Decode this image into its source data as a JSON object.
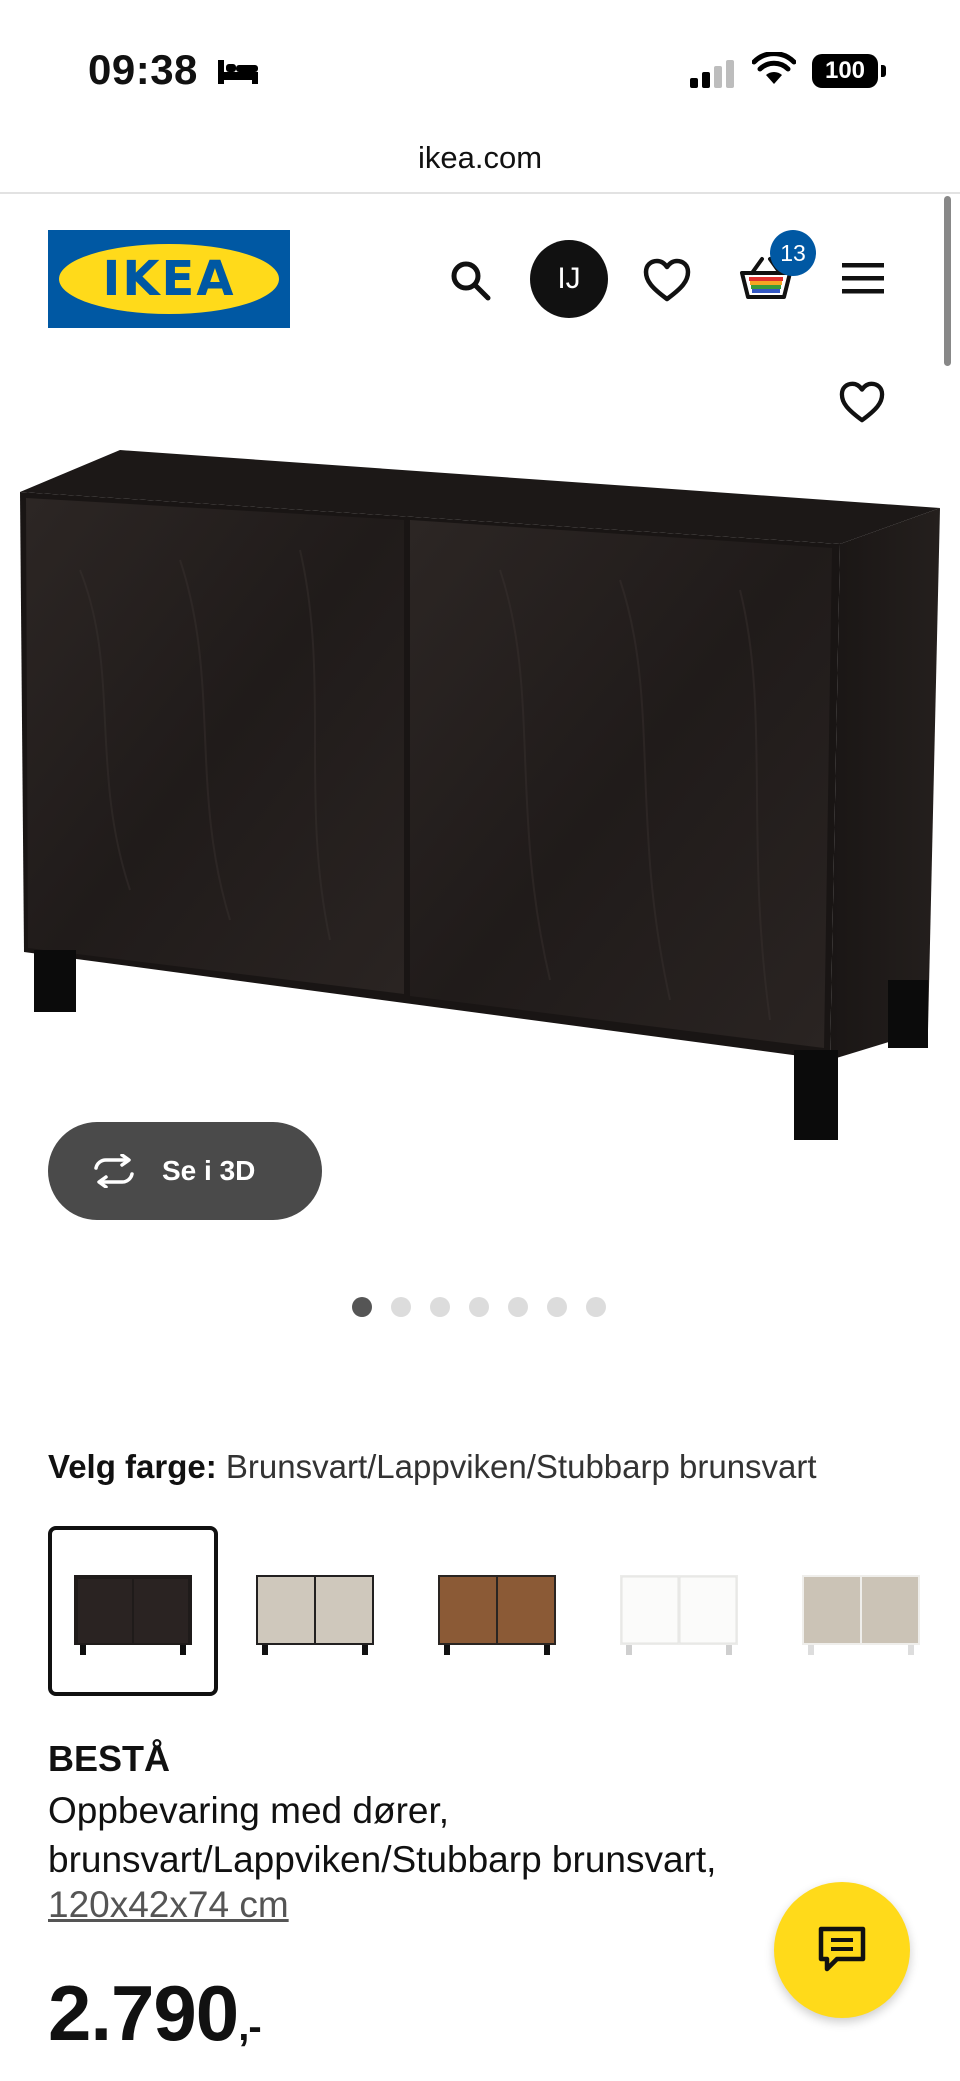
{
  "status_bar": {
    "time": "09:38",
    "battery": "100"
  },
  "browser": {
    "url": "ikea.com"
  },
  "header": {
    "logo_text": "IKEA",
    "avatar_initials": "IJ",
    "cart_count": "13"
  },
  "gallery": {
    "view_3d_label": "Se i 3D",
    "image_count": 7,
    "active_image_index": 0
  },
  "color_selector": {
    "label": "Velg farge:",
    "selected_value": "Brunsvart/Lappviken/Stubbarp brunsvart",
    "swatches": [
      {
        "name": "brunsvart",
        "body": "#1f1b1a",
        "door": "#2a2322",
        "legs": "#0e0e0e"
      },
      {
        "name": "beige-black",
        "body": "#222020",
        "door": "#cfc8bc",
        "legs": "#111"
      },
      {
        "name": "walnut",
        "body": "#2a2522",
        "door": "#8b5a36",
        "legs": "#111"
      },
      {
        "name": "white",
        "body": "#f4f4f2",
        "door": "#fbfbfa",
        "legs": "#cfcfcf"
      },
      {
        "name": "beige-white",
        "body": "#f0efec",
        "door": "#cbc3b6",
        "legs": "#ddd"
      }
    ]
  },
  "product": {
    "brand": "BESTÅ",
    "description": "Oppbevaring med dører, brunsvart/Lappviken/Stubbarp brunsvart,",
    "dimensions": "120x42x74 cm",
    "price": "2.790",
    "price_suffix": ",-"
  },
  "colors": {
    "ikea_blue": "#0058a3",
    "ikea_yellow": "#ffda1a",
    "view3d_bg": "#4a4a4a"
  }
}
